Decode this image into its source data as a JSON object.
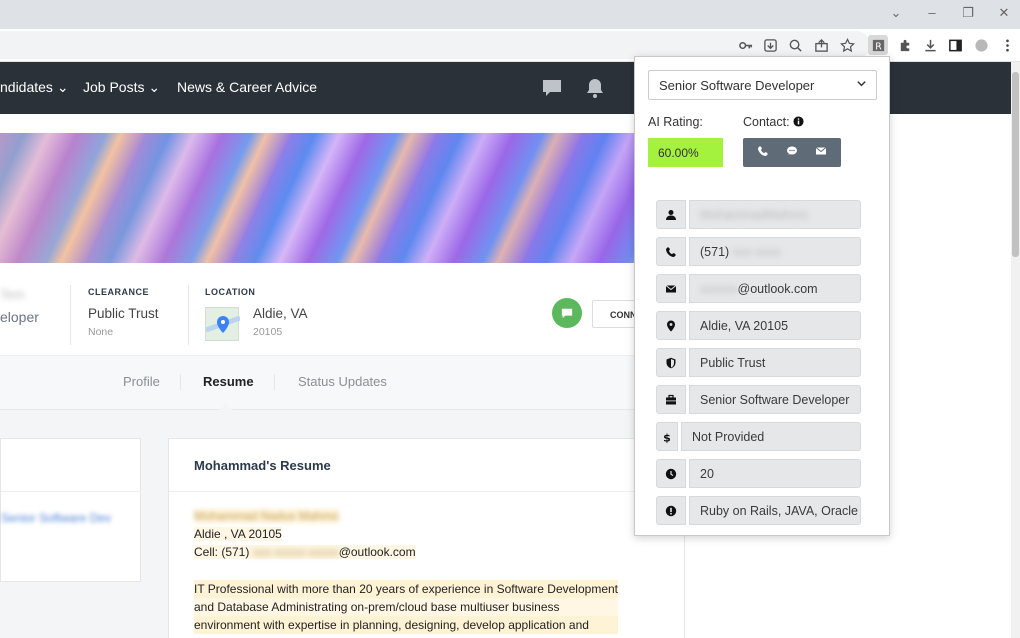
{
  "browser": {
    "window_controls": [
      "chevron-down",
      "minimize",
      "maximize",
      "close"
    ],
    "toolbar_icons": [
      "key",
      "install",
      "zoom",
      "share",
      "star",
      "extension-r",
      "puzzle",
      "download",
      "sidepanel",
      "profile",
      "menu"
    ]
  },
  "nav": {
    "items": [
      {
        "label": "ndidates"
      },
      {
        "label": "Job Posts"
      },
      {
        "label": "News & Career Advice"
      }
    ]
  },
  "profile": {
    "title_fragment": "eloper",
    "clearance_label": "CLEARANCE",
    "clearance_value": "Public Trust",
    "clearance_sub": "None",
    "location_label": "LOCATION",
    "location_city": "Aldie, VA",
    "location_zip": "20105",
    "connect_label": "CONN"
  },
  "tabs": [
    {
      "label": "Profile"
    },
    {
      "label": "Resume"
    },
    {
      "label": "Status Updates"
    }
  ],
  "resume": {
    "heading": "Mohammad's Resume",
    "line_city": "Aldie , VA 20105",
    "line_cell_prefix": "Cell: (571)",
    "line_cell_suffix": "@outlook.com",
    "para": [
      "IT Professional with more than 20 years of experience in Software Development",
      "and Database Administrating on-prem/cloud base multiuser business",
      "environment with expertise in planning, designing, develop application and"
    ]
  },
  "popup": {
    "selected_role": "Senior Software Developer",
    "ai_rating_label": "AI Rating:",
    "ai_rating_value": "60.00%",
    "contact_label": "Contact:",
    "fields": [
      {
        "icon": "user-icon",
        "value": ""
      },
      {
        "icon": "phone-icon",
        "value": "(571)"
      },
      {
        "icon": "envelope-icon",
        "value": "@outlook.com"
      },
      {
        "icon": "map-pin-icon",
        "value": "Aldie, VA 20105"
      },
      {
        "icon": "shield-icon",
        "value": "Public Trust"
      },
      {
        "icon": "briefcase-icon",
        "value": "Senior Software Developer"
      },
      {
        "icon": "dollar-icon",
        "value": "Not Provided"
      },
      {
        "icon": "clock-icon",
        "value": "20"
      },
      {
        "icon": "exclamation-icon",
        "value": "Ruby on Rails, JAVA, Oracle"
      }
    ]
  },
  "colors": {
    "nav_bg": "#2b3138",
    "rating_bg": "#a4f23e",
    "contact_btn_bg": "#5f6b76",
    "status_green": "#5cb85c"
  }
}
